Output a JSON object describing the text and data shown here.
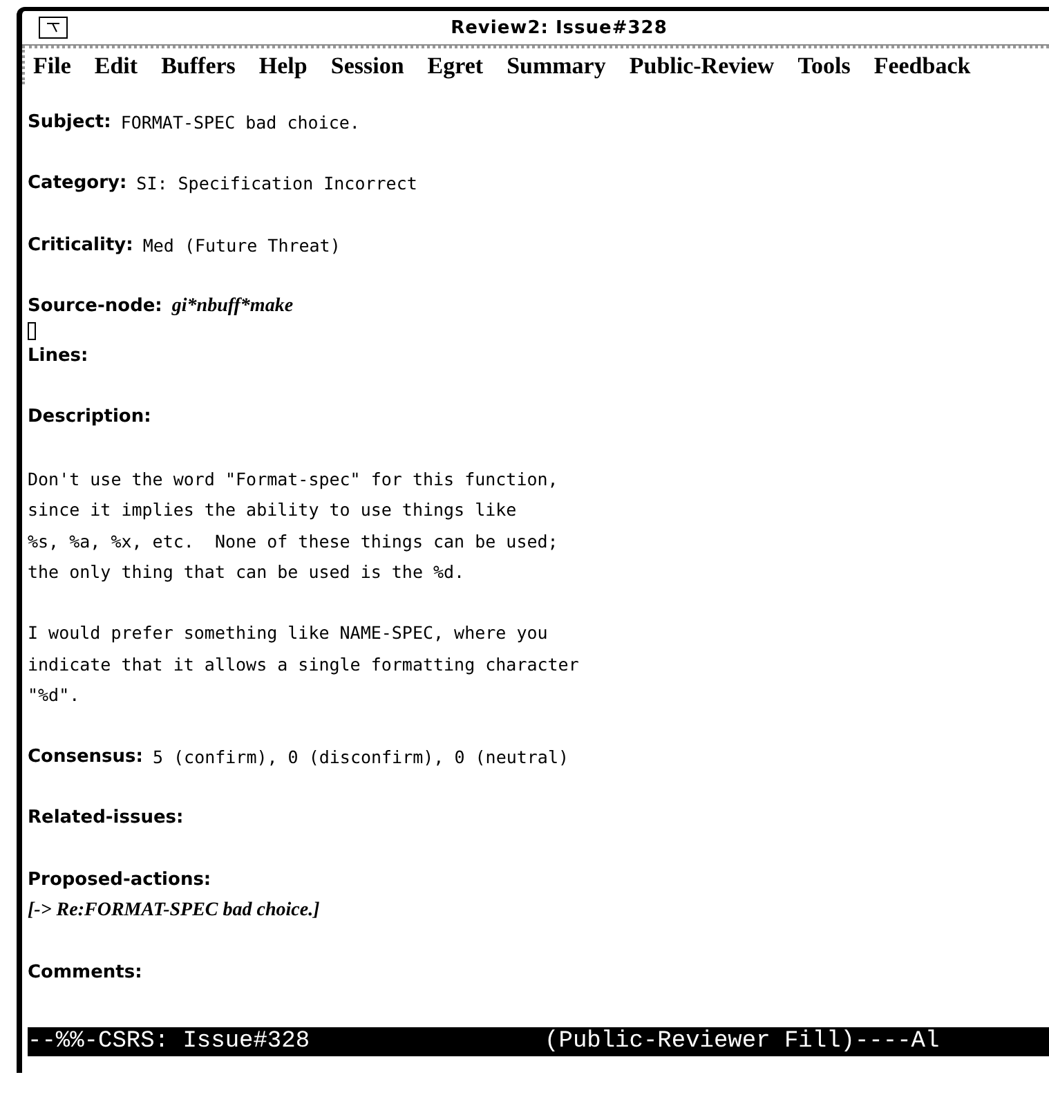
{
  "window": {
    "title": "Review2: Issue#328"
  },
  "menu": [
    "File",
    "Edit",
    "Buffers",
    "Help",
    "Session",
    "Egret",
    "Summary",
    "Public-Review",
    "Tools",
    "Feedback"
  ],
  "sections": [
    {
      "lines": [
        {
          "kind": "field",
          "label": "Subject:",
          "value": "FORMAT-SPEC bad choice."
        }
      ]
    },
    {
      "lines": [
        {
          "kind": "field",
          "label": "Category:",
          "value": "SI: Specification Incorrect"
        }
      ]
    },
    {
      "lines": [
        {
          "kind": "field",
          "label": "Criticality:",
          "value": "Med (Future Threat)"
        }
      ]
    },
    {
      "lines": [
        {
          "kind": "node",
          "label": "Source-node:",
          "value": "gi*nbuff*make"
        },
        {
          "kind": "cursor"
        },
        {
          "kind": "heading",
          "label": "Lines:"
        }
      ]
    },
    {
      "lines": [
        {
          "kind": "heading",
          "label": "Description:"
        }
      ]
    },
    {
      "lines": [
        {
          "kind": "text",
          "value": "Don't use the word \"Format-spec\" for this function,"
        },
        {
          "kind": "text",
          "value": "since it implies the ability to use things like"
        },
        {
          "kind": "text",
          "value": "%s, %a, %x, etc.  None of these things can be used;"
        },
        {
          "kind": "text",
          "value": "the only thing that can be used is the %d."
        }
      ]
    },
    {
      "lines": [
        {
          "kind": "text",
          "value": "I would prefer something like NAME-SPEC, where you"
        },
        {
          "kind": "text",
          "value": "indicate that it allows a single formatting character"
        },
        {
          "kind": "text",
          "value": "\"%d\"."
        }
      ]
    },
    {
      "lines": [
        {
          "kind": "field",
          "label": "Consensus:",
          "value": "5 (confirm), 0 (disconfirm), 0 (neutral)"
        }
      ]
    },
    {
      "lines": [
        {
          "kind": "heading",
          "label": "Related-issues:"
        }
      ]
    },
    {
      "lines": [
        {
          "kind": "heading",
          "label": "Proposed-actions:"
        },
        {
          "kind": "link",
          "value": "[-> Re:FORMAT-SPEC bad choice.]"
        }
      ]
    },
    {
      "lines": [
        {
          "kind": "heading",
          "label": "Comments:"
        }
      ]
    }
  ],
  "modeline": {
    "left": "--%%-CSRS: Issue#328",
    "right": "(Public-Reviewer Fill)----Al"
  }
}
